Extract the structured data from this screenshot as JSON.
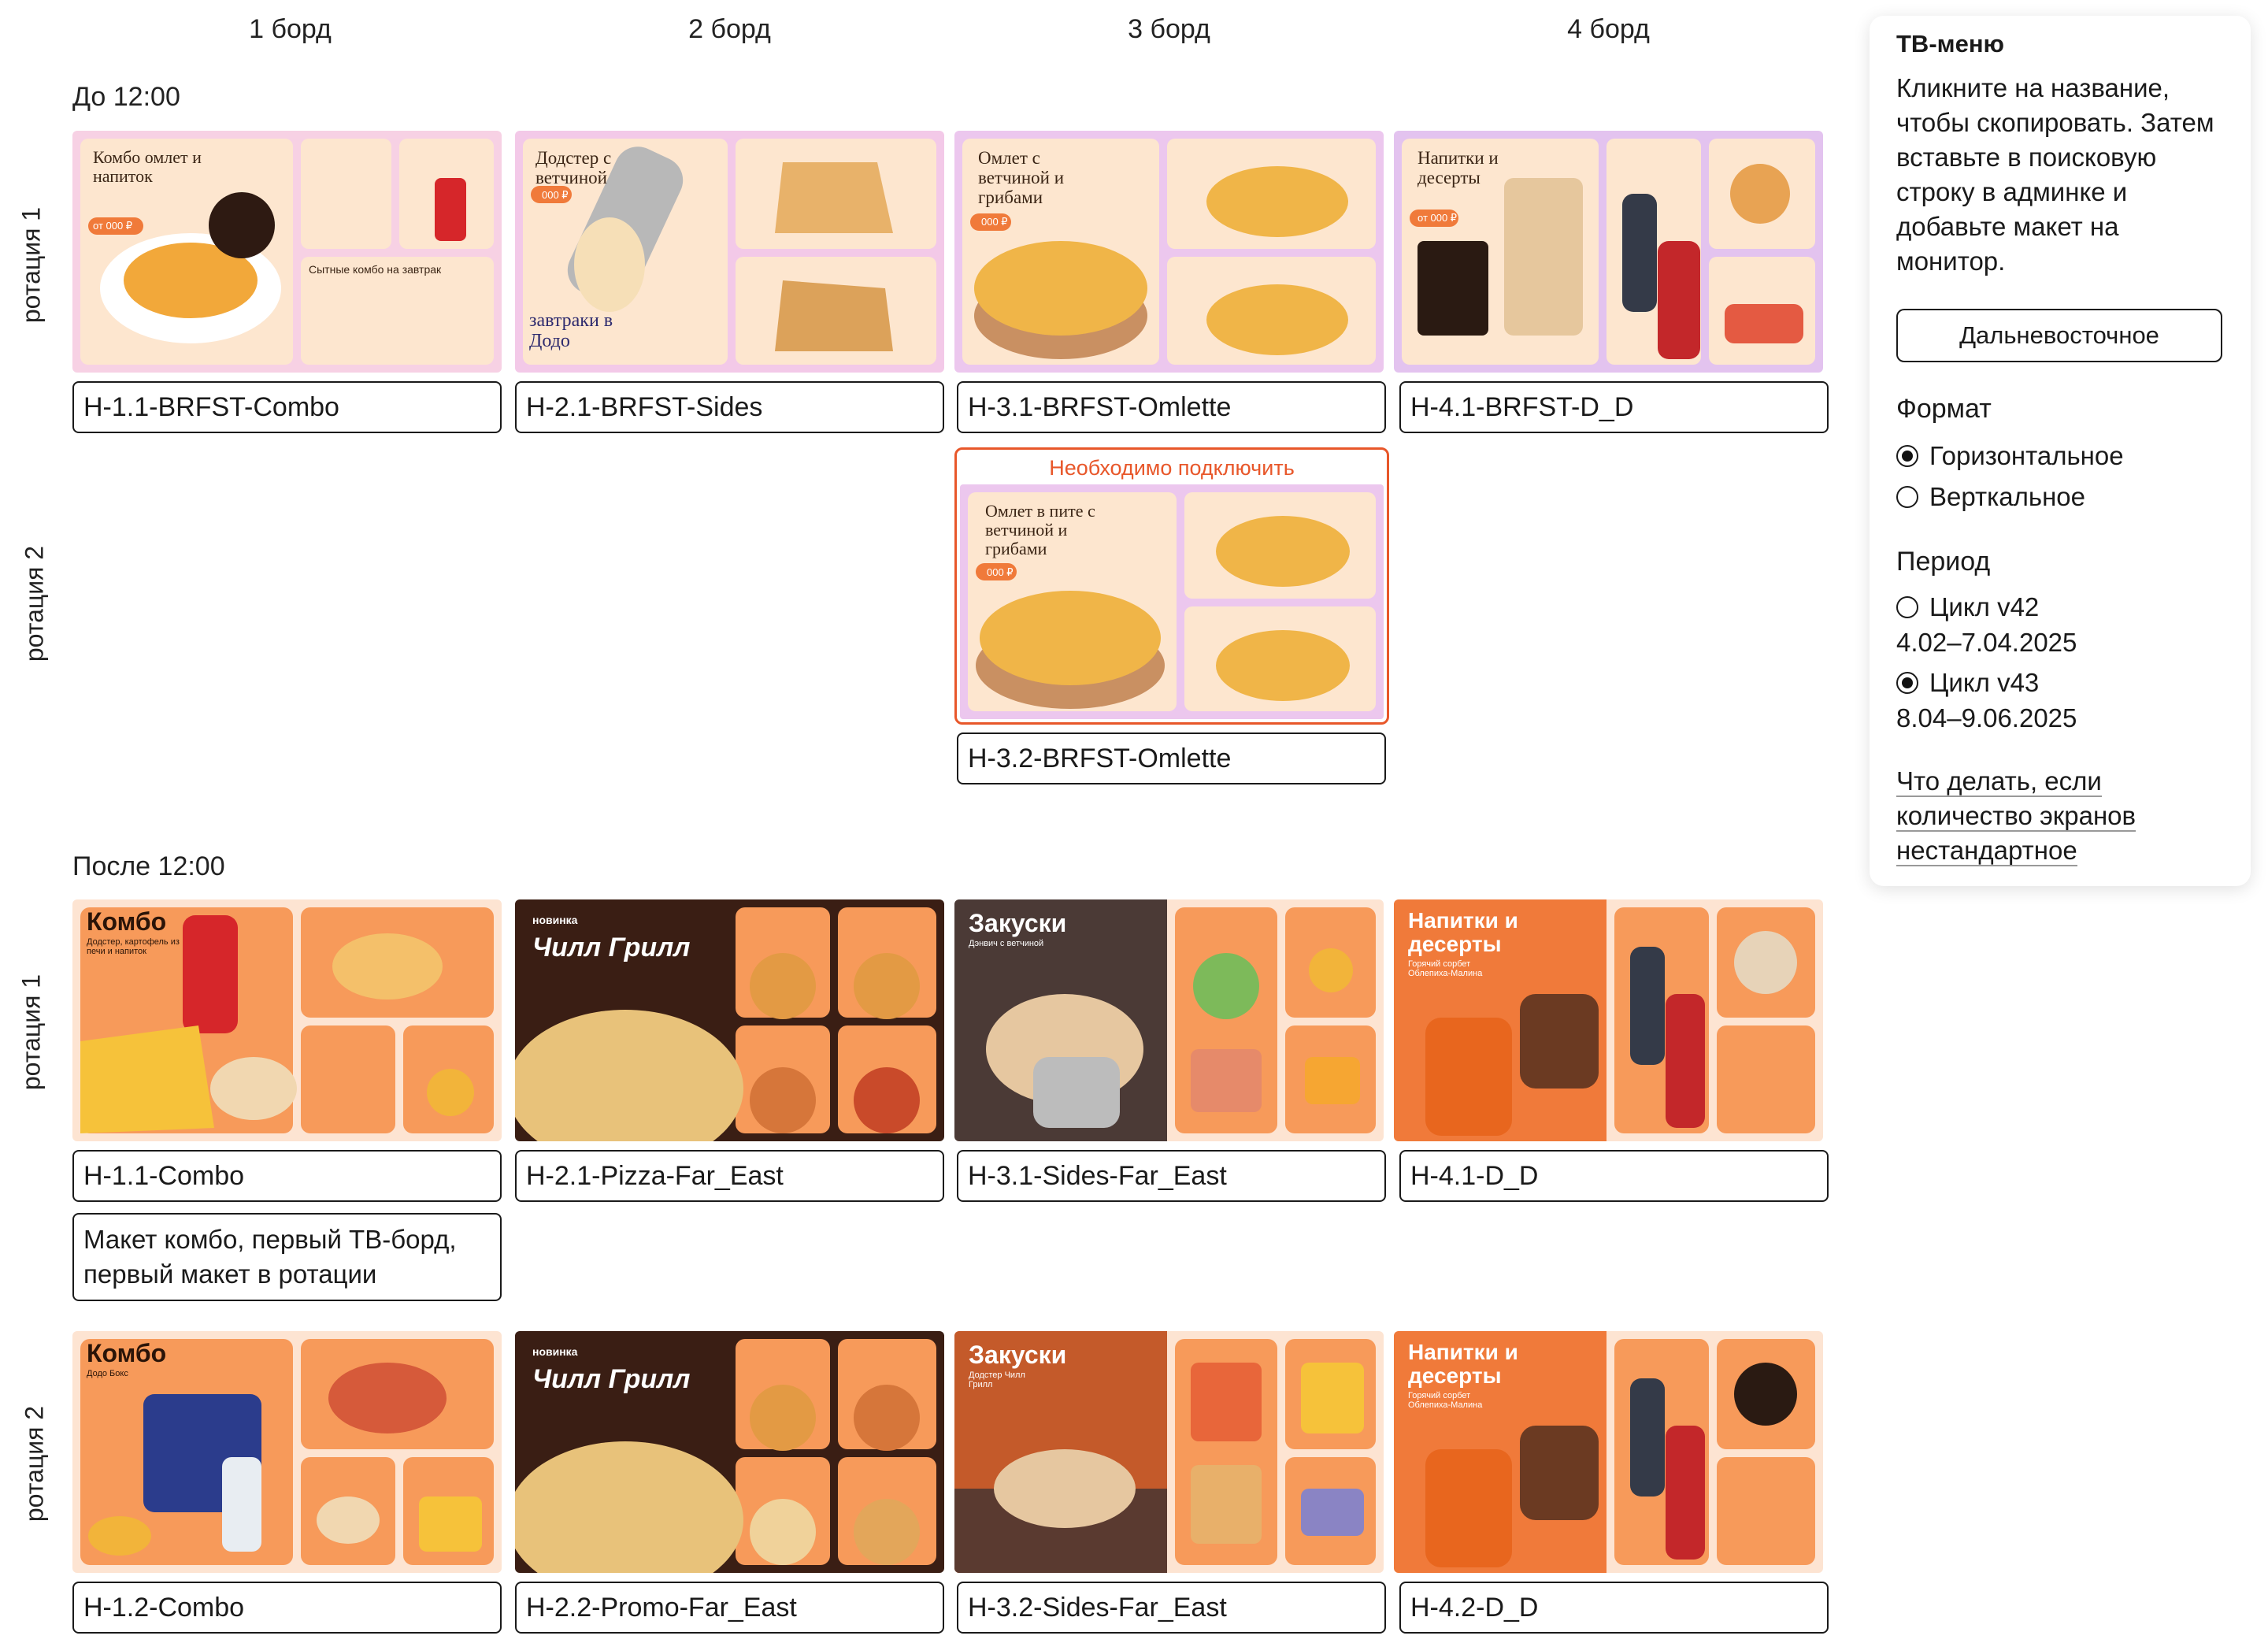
{
  "boards": [
    "1 борд",
    "2 борд",
    "3 борд",
    "4 борд"
  ],
  "sections": {
    "morning": "До 12:00",
    "afternoon": "После 12:00"
  },
  "rotations": {
    "r1": "ротация 1",
    "r2": "ротация 2"
  },
  "morning": {
    "r1": [
      "H-1.1-BRFST-Combo",
      "H-2.1-BRFST-Sides",
      "H-3.1-BRFST-Omlette",
      "H-4.1-BRFST-D_D"
    ],
    "r2_board3": "H-3.2-BRFST-Omlette",
    "warning": "Необходимо подключить"
  },
  "afternoon": {
    "r1": [
      "H-1.1-Combo",
      "H-2.1-Pizza-Far_East",
      "H-3.1-Sides-Far_East",
      "H-4.1-D_D"
    ],
    "r1_note": "Макет комбо, первый ТВ-борд, первый макет в ротации",
    "r2": [
      "H-1.2-Combo",
      "H-2.2-Promo-Far_East",
      "H-3.2-Sides-Far_East",
      "H-4.2-D_D"
    ]
  },
  "thumbs": {
    "m1": {
      "title": "Комбо омлет и напиток",
      "price": "от 000 ₽",
      "sub": "Сытные комбо на завтрак"
    },
    "m2": {
      "title": "Додстер с ветчиной",
      "price": "000 ₽",
      "sub": "завтраки в Додо"
    },
    "m3": {
      "title": "Омлет с ветчиной и грибами",
      "price": "000 ₽"
    },
    "m4": {
      "title": "Напитки и десерты",
      "price": "от 000 ₽"
    },
    "m5": {
      "title": "Омлет в пите с ветчиной и грибами",
      "price": "000 ₽"
    },
    "a1": {
      "title": "Комбо",
      "sub": "Додстер, картофель из печи и напиток"
    },
    "a2": {
      "title": "новинка",
      "sub": "Чилл Грилл"
    },
    "a3": {
      "title": "Закуски",
      "sub": "Дэнвич с ветчиной"
    },
    "a4": {
      "title": "Напитки и десерты",
      "sub": "Горячий сорбет Облепиха-Малина"
    },
    "b1": {
      "title": "Комбо",
      "sub": "Додо Бокс"
    },
    "b2": {
      "title": "новинка",
      "sub": "Чилл Грилл"
    },
    "b3": {
      "title": "Закуски",
      "sub": "Додстер Чилл Грилл"
    },
    "b4": {
      "title": "Напитки и десерты",
      "sub": "Горячий сорбет Облепиха-Малина"
    }
  },
  "panel": {
    "title": "ТВ-меню",
    "instructions": "Кликните на название, чтобы скопировать. Затем вставьте в поисковую строку в админке и добавьте макет на монитор.",
    "region_button": "Дальневосточное",
    "format_label": "Формат",
    "formats": [
      {
        "label": "Горизонтальное",
        "selected": true
      },
      {
        "label": "Верткальное",
        "selected": false
      }
    ],
    "period_label": "Период",
    "periods": [
      {
        "label": "Цикл v42",
        "dates": "4.02–7.04.2025",
        "selected": false
      },
      {
        "label": "Цикл v43",
        "dates": "8.04–9.06.2025",
        "selected": true
      }
    ],
    "help_link": "Что делать, если количество экранов нестандартное"
  },
  "colors": {
    "accent": "#e8572a",
    "light_bg": "#fde4d2",
    "dark_bg": "#3a1e14"
  }
}
